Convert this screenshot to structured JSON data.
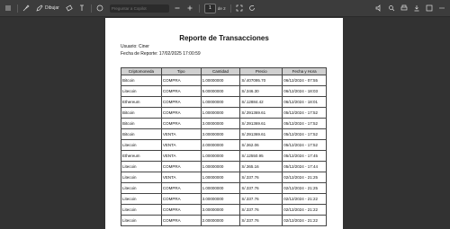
{
  "toolbar": {
    "draw_label": "Dibujar",
    "search_placeholder": "Preguntar a Copilot",
    "page_current": "1",
    "page_total": "de 2"
  },
  "report": {
    "title": "Reporte de Transacciones",
    "user_line": "Usuario: Ciner",
    "date_line": "Fecha de Reporte: 17/02/2025 17:00:59",
    "columns": [
      "Criptomoneda",
      "Tipo",
      "Cantidad",
      "Precio",
      "Fecha y Hora"
    ],
    "rows": [
      [
        "Bitcoin",
        "COMPRA",
        "1.00000000",
        "S/.407095.70",
        "06/12/2024 - 07:55"
      ],
      [
        "Litecoin",
        "COMPRA",
        "5.00000000",
        "S/.346.30",
        "06/12/2024 - 18:03"
      ],
      [
        "Ethereum",
        "COMPRA",
        "1.00000000",
        "S/.12884.42",
        "06/12/2024 - 18:01"
      ],
      [
        "Bitcoin",
        "COMPRA",
        "1.00000000",
        "S/.391369.61",
        "05/12/2024 - 17:52"
      ],
      [
        "Bitcoin",
        "COMPRA",
        "3.00000000",
        "S/.391369.61",
        "05/12/2024 - 17:52"
      ],
      [
        "Bitcoin",
        "VENTA",
        "3.00000000",
        "S/.391369.61",
        "05/12/2024 - 17:52"
      ],
      [
        "Litecoin",
        "VENTA",
        "2.00000000",
        "S/.362.06",
        "05/12/2024 - 17:52"
      ],
      [
        "Ethereum",
        "VENTA",
        "1.00000000",
        "S/.12550.95",
        "05/12/2024 - 17:45"
      ],
      [
        "Litecoin",
        "COMPRA",
        "1.00000000",
        "S/.365.16",
        "05/12/2024 - 17:44"
      ],
      [
        "Litecoin",
        "VENTA",
        "1.00000000",
        "S/.337.76",
        "02/12/2024 - 21:25"
      ],
      [
        "Litecoin",
        "COMPRA",
        "1.00000000",
        "S/.337.76",
        "02/12/2024 - 21:25"
      ],
      [
        "Litecoin",
        "COMPRA",
        "3.00000000",
        "S/.337.76",
        "02/12/2024 - 21:22"
      ],
      [
        "Litecoin",
        "COMPRA",
        "3.00000000",
        "S/.337.76",
        "02/12/2024 - 21:22"
      ],
      [
        "Litecoin",
        "COMPRA",
        "2.00000000",
        "S/.337.76",
        "02/12/2024 - 21:22"
      ]
    ]
  }
}
